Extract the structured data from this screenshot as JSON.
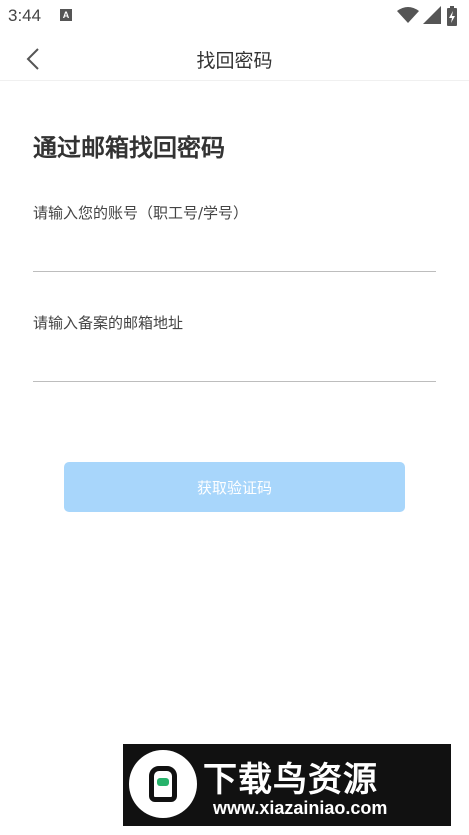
{
  "status_bar": {
    "time": "3:44",
    "notification_icon": "A"
  },
  "header": {
    "title": "找回密码",
    "back_icon": "chevron-left-icon"
  },
  "form": {
    "heading": "通过邮箱找回密码",
    "account_label": "请输入您的账号（职工号/学号）",
    "account_value": "",
    "email_label": "请输入备案的邮箱地址",
    "email_value": "",
    "submit_label": "获取验证码",
    "submit_color": "#a8d6fb"
  },
  "watermark": {
    "title": "下载鸟资源",
    "url": "www.xiazainiao.com"
  }
}
